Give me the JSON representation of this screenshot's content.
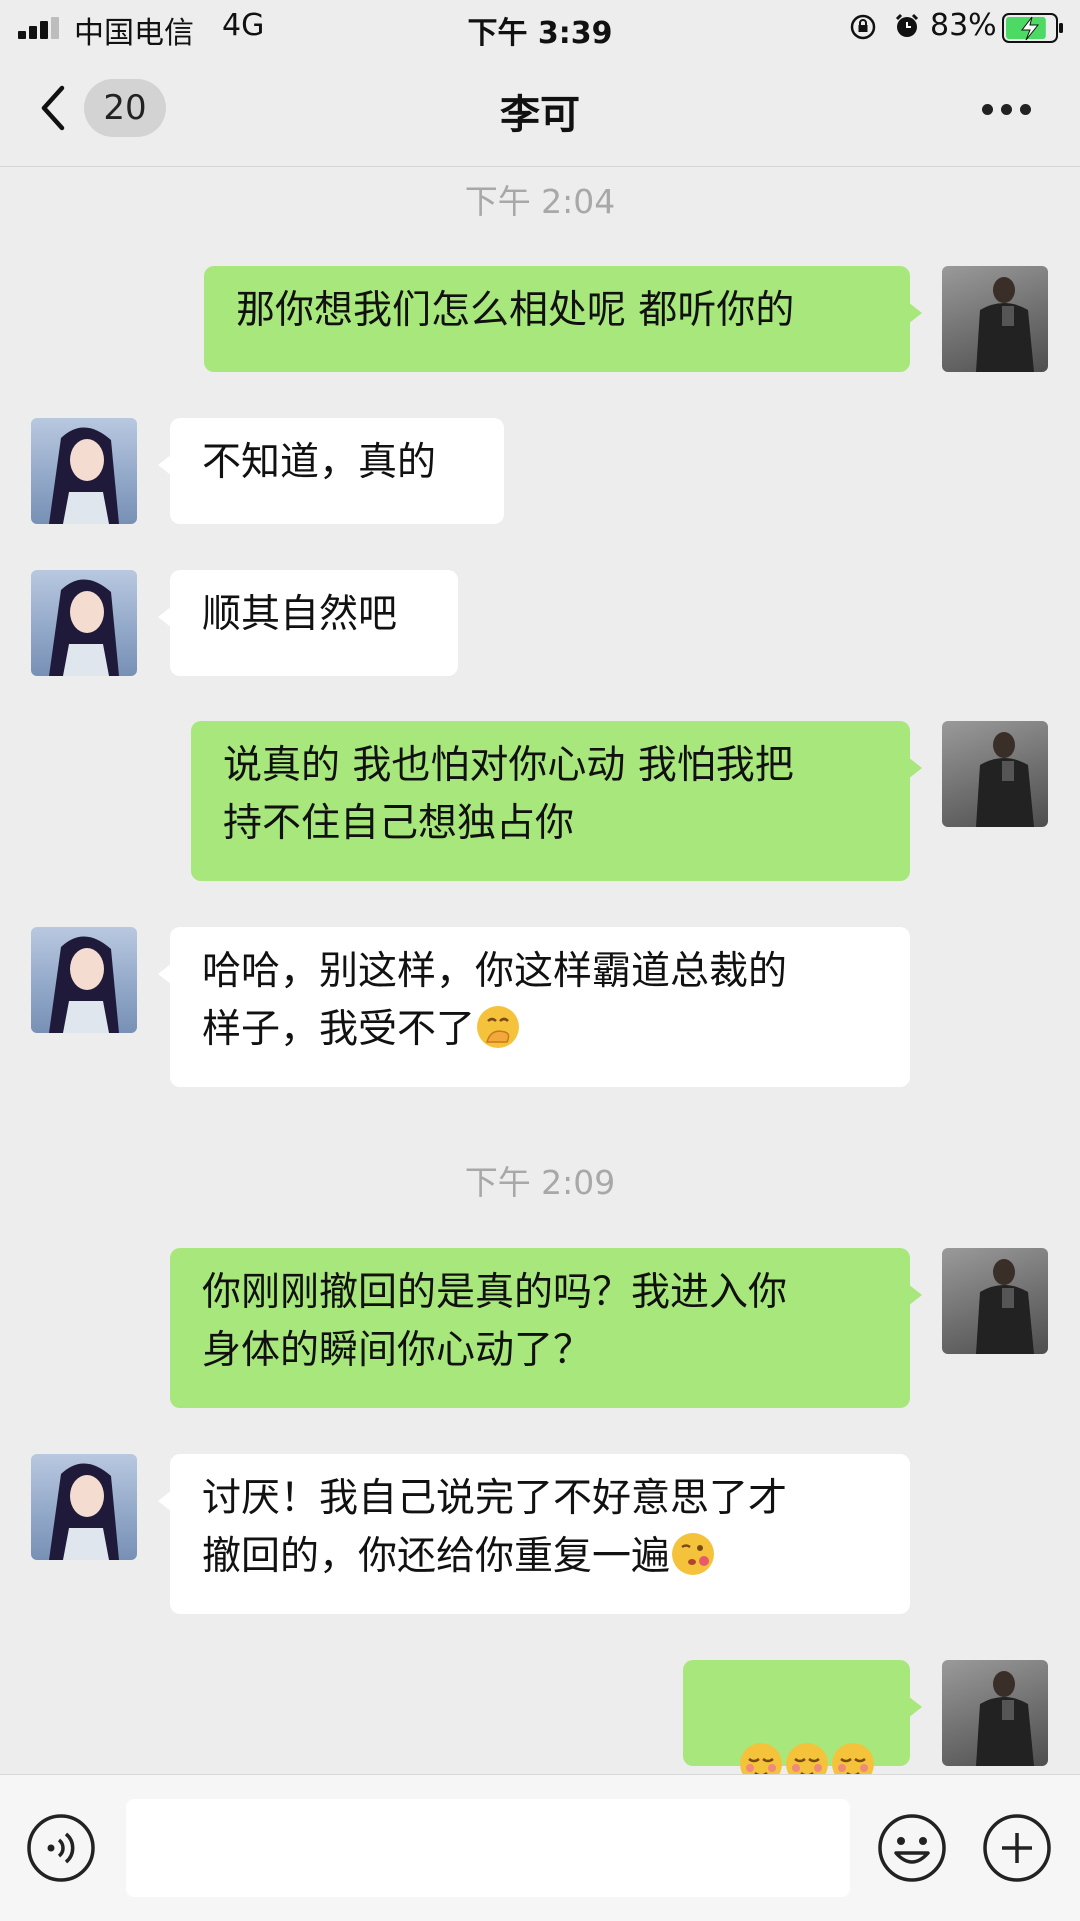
{
  "status_bar": {
    "carrier": "中国电信",
    "network": "4G",
    "time": "下午 3:39",
    "battery_percent": "83%",
    "battery_level": 0.83
  },
  "header": {
    "unread_count": "20",
    "title": "李可"
  },
  "timestamps": [
    "下午 2:04",
    "下午 2:09"
  ],
  "messages": [
    {
      "from": "me",
      "text": "那你想我们怎么相处呢 都听你的"
    },
    {
      "from": "her",
      "text": "不知道，真的"
    },
    {
      "from": "her",
      "text": "顺其自然吧"
    },
    {
      "from": "me",
      "text": "说真的 我也怕对你心动 我怕我把\n持不住自己想独占你"
    },
    {
      "from": "her",
      "text": "哈哈，别这样，你这样霸道总裁的\n样子，我受不了",
      "emoji": "hand-over-mouth-emoji"
    },
    {
      "from": "me",
      "text": "你刚刚撤回的是真的吗？我进入你\n身体的瞬间你心动了？"
    },
    {
      "from": "her",
      "text": "讨厌！我自己说完了不好意思了才\n撤回的，你还给你重复一遍",
      "emoji": "kiss-emoji"
    },
    {
      "from": "me",
      "text": "",
      "emojis": [
        "blush-emoji",
        "blush-emoji",
        "blush-emoji"
      ]
    }
  ],
  "input": {
    "value": "",
    "placeholder": ""
  },
  "colors": {
    "background": "#ededed",
    "my_bubble": "#a8e77b",
    "their_bubble": "#ffffff",
    "timestamp": "#a8a8a8"
  }
}
